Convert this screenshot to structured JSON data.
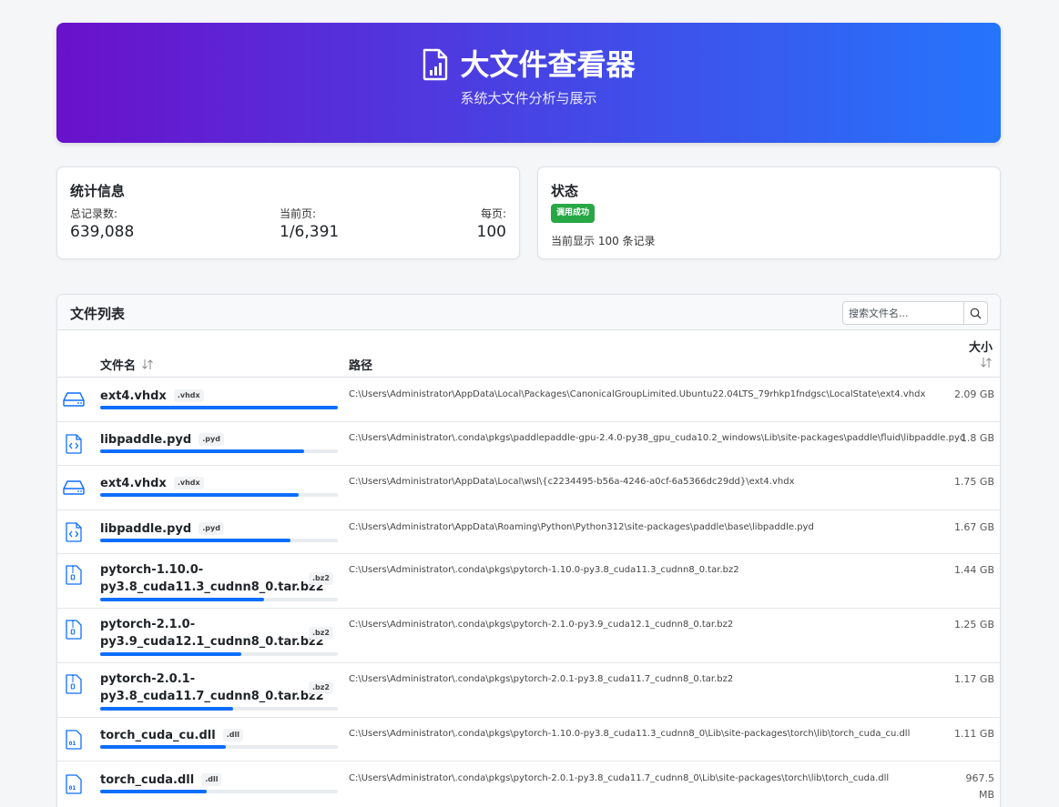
{
  "header": {
    "title": "大文件查看器",
    "subtitle": "系统大文件分析与展示",
    "icon": "file-chart-icon"
  },
  "stats": {
    "title": "统计信息",
    "total_label": "总记录数:",
    "total_value": "639,088",
    "page_label": "当前页:",
    "page_value": "1/6,391",
    "per_page_label": "每页:",
    "per_page_value": "100"
  },
  "status": {
    "title": "状态",
    "badge": "调用成功",
    "text": "当前显示 100 条记录",
    "badge_color": "#28a745"
  },
  "list": {
    "title": "文件列表",
    "search_placeholder": "搜索文件名...",
    "columns": {
      "name": "文件名",
      "path": "路径",
      "size": "大小"
    },
    "accent": "#0d6efd",
    "rows": [
      {
        "icon": "hard-drive-icon",
        "name": "ext4.vhdx",
        "ext": ".vhdx",
        "path": "C:\\Users\\Administrator\\AppData\\Local\\Packages\\CanonicalGroupLimited.Ubuntu22.04LTS_79rhkp1fndgsc\\LocalState\\ext4.vhdx",
        "size": "2.09 GB",
        "fraction": 1.0
      },
      {
        "icon": "code-file-icon",
        "name": "libpaddle.pyd",
        "ext": ".pyd",
        "path": "C:\\Users\\Administrator\\.conda\\pkgs\\paddlepaddle-gpu-2.4.0-py38_gpu_cuda10.2_windows\\Lib\\site-packages\\paddle\\fluid\\libpaddle.pyd",
        "size": "1.8 GB",
        "fraction": 0.86
      },
      {
        "icon": "hard-drive-icon",
        "name": "ext4.vhdx",
        "ext": ".vhdx",
        "path": "C:\\Users\\Administrator\\AppData\\Local\\wsl\\{c2234495-b56a-4246-a0cf-6a5366dc29dd}\\ext4.vhdx",
        "size": "1.75 GB",
        "fraction": 0.836
      },
      {
        "icon": "code-file-icon",
        "name": "libpaddle.pyd",
        "ext": ".pyd",
        "path": "C:\\Users\\Administrator\\AppData\\Roaming\\Python\\Python312\\site-packages\\paddle\\base\\libpaddle.pyd",
        "size": "1.67 GB",
        "fraction": 0.8
      },
      {
        "icon": "zip-file-icon",
        "name": "pytorch-1.10.0-py3.8_cuda11.3_cudnn8_0.tar.bz2",
        "name_line1": "pytorch-1.10.0-",
        "name_line2": "py3.8_cuda11.3_cudnn8_0.tar.bz2",
        "ext": ".bz2",
        "path": "C:\\Users\\Administrator\\.conda\\pkgs\\pytorch-1.10.0-py3.8_cuda11.3_cudnn8_0.tar.bz2",
        "size": "1.44 GB",
        "fraction": 0.69
      },
      {
        "icon": "zip-file-icon",
        "name_line1": "pytorch-2.1.0-",
        "name_line2": "py3.9_cuda12.1_cudnn8_0.tar.bz2",
        "ext": ".bz2",
        "path": "C:\\Users\\Administrator\\.conda\\pkgs\\pytorch-2.1.0-py3.9_cuda12.1_cudnn8_0.tar.bz2",
        "size": "1.25 GB",
        "fraction": 0.595
      },
      {
        "icon": "zip-file-icon",
        "name_line1": "pytorch-2.0.1-",
        "name_line2": "py3.8_cuda11.7_cudnn8_0.tar.bz2",
        "ext": ".bz2",
        "path": "C:\\Users\\Administrator\\.conda\\pkgs\\pytorch-2.0.1-py3.8_cuda11.7_cudnn8_0.tar.bz2",
        "size": "1.17 GB",
        "fraction": 0.56
      },
      {
        "icon": "binary-file-icon",
        "name": "torch_cuda_cu.dll",
        "ext": ".dll",
        "path": "C:\\Users\\Administrator\\.conda\\pkgs\\pytorch-1.10.0-py3.8_cuda11.3_cudnn8_0\\Lib\\site-packages\\torch\\lib\\torch_cuda_cu.dll",
        "size": "1.11 GB",
        "fraction": 0.53
      },
      {
        "icon": "binary-file-icon",
        "name": "torch_cuda.dll",
        "ext": ".dll",
        "path": "C:\\Users\\Administrator\\.conda\\pkgs\\pytorch-2.0.1-py3.8_cuda11.7_cudnn8_0\\Lib\\site-packages\\torch\\lib\\torch_cuda.dll",
        "size_line1": "967.5",
        "size_line2": "MB",
        "fraction": 0.45
      }
    ]
  }
}
